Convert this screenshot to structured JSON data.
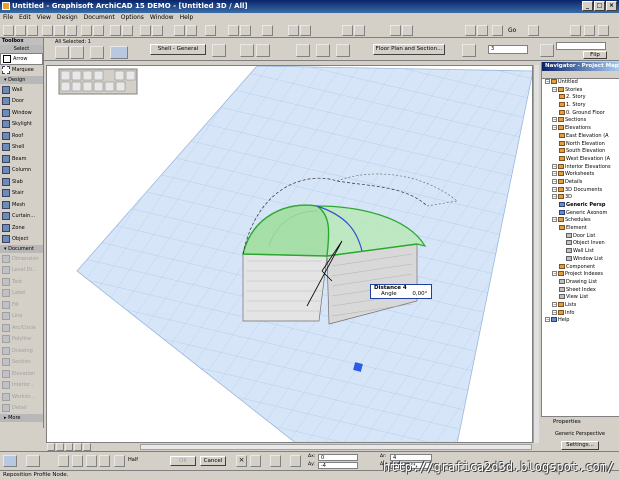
{
  "window": {
    "title": "Untitled - Graphisoft ArchiCAD 15 DEMO - [Untitled 3D / All]"
  },
  "menu": [
    "File",
    "Edit",
    "View",
    "Design",
    "Document",
    "Options",
    "Window",
    "Help"
  ],
  "infobox": {
    "all_selected": "All Selected: 1",
    "shell_label": "Shell - General",
    "floor_plan_button": "Floor Plan and Section...",
    "field_value": "3",
    "go_label": "Go",
    "flip_label": "Flip"
  },
  "toolbox": {
    "title": "Toolbox",
    "select_label": "Select",
    "arrow": "Arrow",
    "marquee": "Marquee",
    "design_section": "Design",
    "design_tools": [
      "Wall",
      "Door",
      "Window",
      "Skylight",
      "Roof",
      "Shell",
      "Beam",
      "Column",
      "Slab",
      "Stair",
      "Mesh",
      "Curtain...",
      "Zone",
      "Object"
    ],
    "document_section": "Document",
    "document_tools": [
      "Dimension",
      "Level Di...",
      "Text",
      "Label",
      "Fill",
      "Line",
      "Arc/Circle",
      "Polyline",
      "Drawing",
      "Section",
      "Elevation",
      "Interior...",
      "Worksh...",
      "Detail"
    ],
    "more": "More"
  },
  "navigator": {
    "title": "Navigator - Project Map",
    "tree": [
      {
        "label": "Untitled",
        "level": 0,
        "icon": "house-icon"
      },
      {
        "label": "Stories",
        "level": 1,
        "icon": "folder-icon"
      },
      {
        "label": "2. Story",
        "level": 2,
        "icon": "story-icon"
      },
      {
        "label": "1. Story",
        "level": 2,
        "icon": "story-icon"
      },
      {
        "label": "0. Ground Floor",
        "level": 2,
        "icon": "story-icon"
      },
      {
        "label": "Sections",
        "level": 1,
        "icon": "folder-icon"
      },
      {
        "label": "Elevations",
        "level": 1,
        "icon": "folder-icon"
      },
      {
        "label": "East Elevation (A",
        "level": 2,
        "icon": "elevation-icon"
      },
      {
        "label": "North Elevation",
        "level": 2,
        "icon": "elevation-icon"
      },
      {
        "label": "South Elevation",
        "level": 2,
        "icon": "elevation-icon"
      },
      {
        "label": "West Elevation (A",
        "level": 2,
        "icon": "elevation-icon"
      },
      {
        "label": "Interior Elevations",
        "level": 1,
        "icon": "folder-icon"
      },
      {
        "label": "Worksheets",
        "level": 1,
        "icon": "folder-icon"
      },
      {
        "label": "Details",
        "level": 1,
        "icon": "folder-icon"
      },
      {
        "label": "3D Documents",
        "level": 1,
        "icon": "folder-icon"
      },
      {
        "label": "3D",
        "level": 1,
        "icon": "folder-icon"
      },
      {
        "label": "Generic Persp",
        "level": 2,
        "icon": "camera-icon"
      },
      {
        "label": "Generic Axonom",
        "level": 2,
        "icon": "camera-icon"
      },
      {
        "label": "Schedules",
        "level": 1,
        "icon": "folder-icon"
      },
      {
        "label": "Element",
        "level": 2,
        "icon": "folder-icon"
      },
      {
        "label": "Door List",
        "level": 3,
        "icon": "list-icon"
      },
      {
        "label": "Object Inven",
        "level": 3,
        "icon": "list-icon"
      },
      {
        "label": "Wall List",
        "level": 3,
        "icon": "list-icon"
      },
      {
        "label": "Window List",
        "level": 3,
        "icon": "list-icon"
      },
      {
        "label": "Component",
        "level": 2,
        "icon": "folder-icon"
      },
      {
        "label": "Project Indexes",
        "level": 1,
        "icon": "folder-icon"
      },
      {
        "label": "Drawing List",
        "level": 2,
        "icon": "list-icon"
      },
      {
        "label": "Sheet Index",
        "level": 2,
        "icon": "list-icon"
      },
      {
        "label": "View List",
        "level": 2,
        "icon": "list-icon"
      },
      {
        "label": "Lists",
        "level": 1,
        "icon": "folder-icon"
      },
      {
        "label": "Info",
        "level": 1,
        "icon": "folder-icon"
      },
      {
        "label": "Help",
        "level": 0,
        "icon": "help-icon"
      }
    ],
    "properties_label": "Properties",
    "properties_value": "Generic Perspective",
    "settings_button": "Settings..."
  },
  "tracker": {
    "distance_label": "Distance",
    "distance_value": "4",
    "angle_label": "Angle",
    "angle_value": "0,00°"
  },
  "coordbar": {
    "half_label": "Half",
    "ok_label": "OK",
    "cancel_label": "Cancel",
    "dx_value": "0",
    "dy_value": "-4",
    "dr_value": "4",
    "da_value": "270,00°"
  },
  "status": "Reposition Profile Node.",
  "watermark": "http://grafica2d3d.blogspot.com/",
  "colors": {
    "accent": "#0a246a",
    "shell_green": "#4cc850",
    "grid_plane": "#cfe0f5"
  }
}
